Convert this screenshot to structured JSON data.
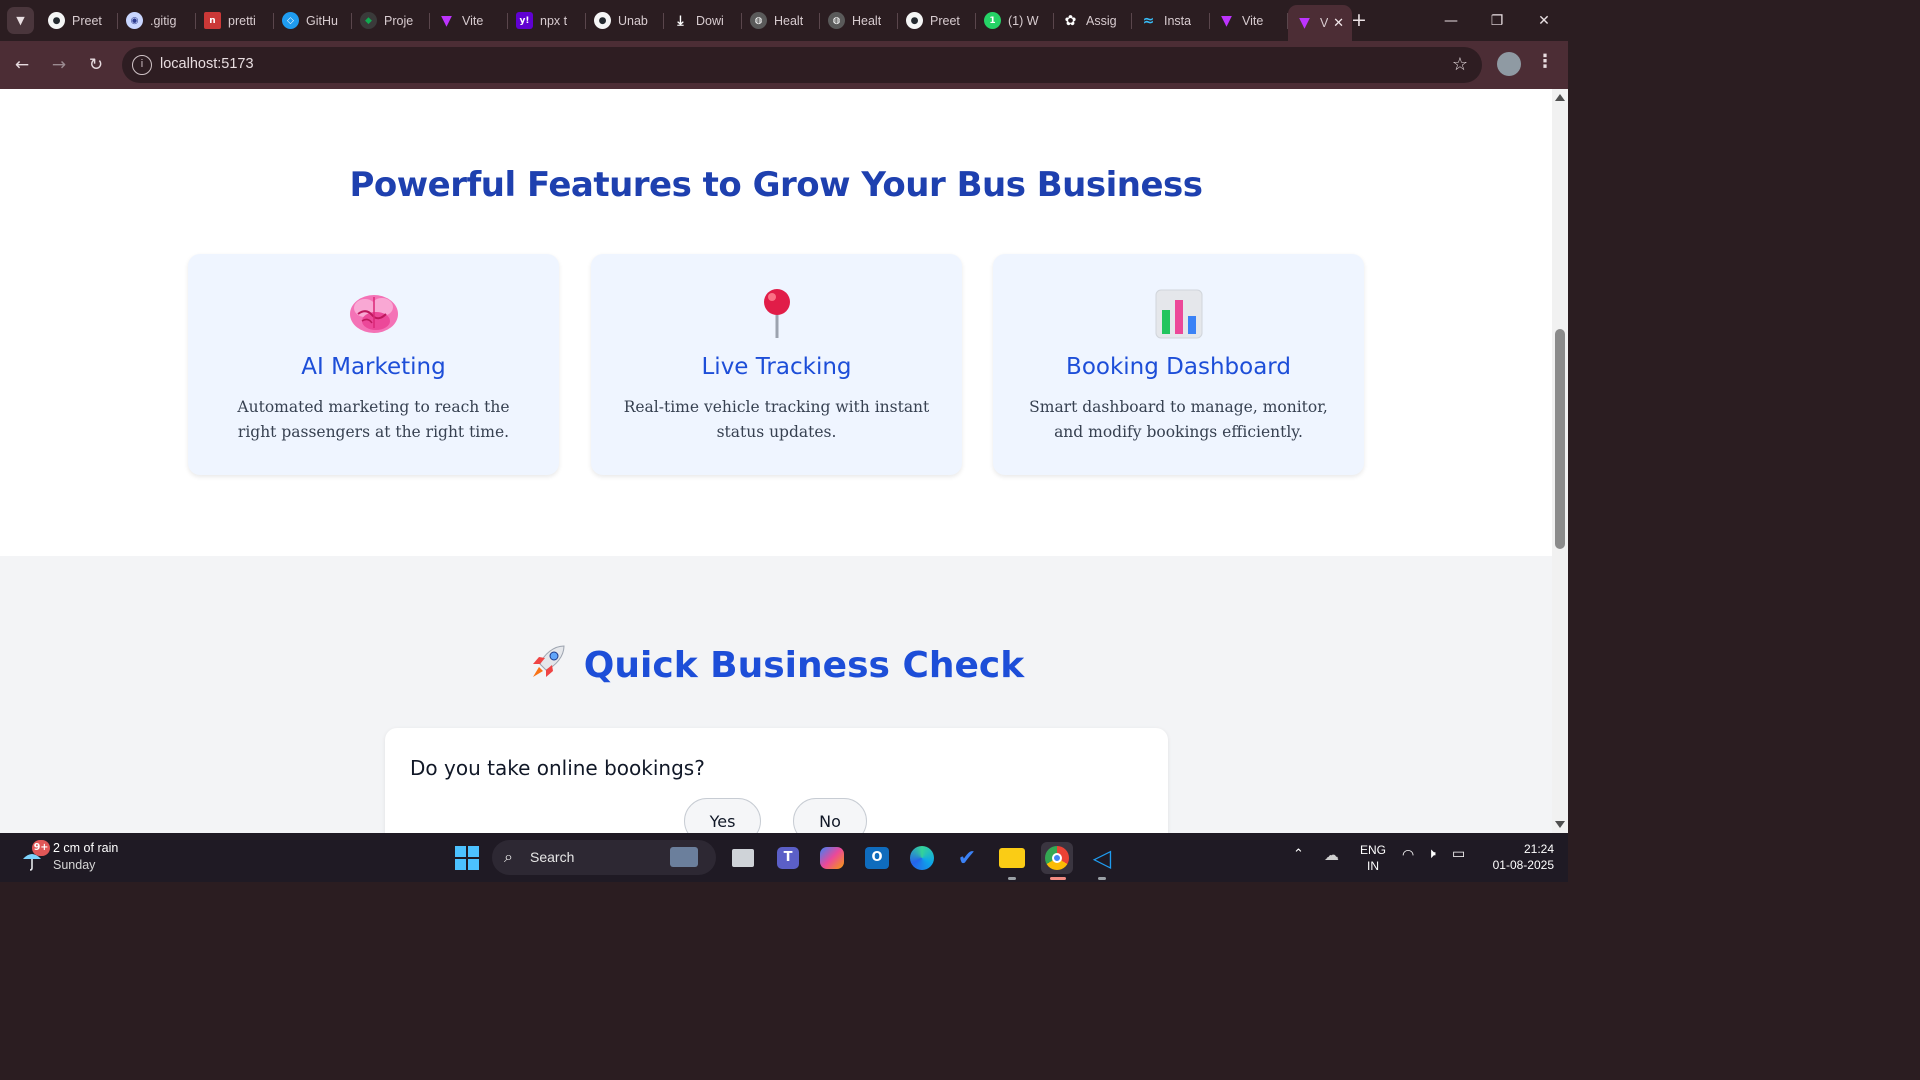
{
  "browser": {
    "tabs": [
      {
        "title": "Preet",
        "icon": "github-icon",
        "color": "#ffffff"
      },
      {
        "title": ".gitig",
        "icon": "avatar-icon",
        "color": "#c9d6ff"
      },
      {
        "title": "pretti",
        "icon": "npm-icon",
        "color": "#cb3837"
      },
      {
        "title": "GitHu",
        "icon": "vscode-icon",
        "color": "#1f9cf0"
      },
      {
        "title": "Proje",
        "icon": "mongodb-icon",
        "color": "#10aa50"
      },
      {
        "title": "Vite",
        "icon": "vite-icon",
        "color": "#a259ff"
      },
      {
        "title": "npx t",
        "icon": "yahoo-icon",
        "color": "#6001d2"
      },
      {
        "title": "Unab",
        "icon": "github-icon",
        "color": "#ffffff"
      },
      {
        "title": "Dowi",
        "icon": "download-icon",
        "color": "#ffffff"
      },
      {
        "title": "Healt",
        "icon": "globe-icon",
        "color": "#ffffff"
      },
      {
        "title": "Healt",
        "icon": "globe-icon",
        "color": "#ffffff"
      },
      {
        "title": "Preet",
        "icon": "github-icon",
        "color": "#ffffff"
      },
      {
        "title": "(1) W",
        "icon": "whatsapp-icon",
        "color": "#25d366"
      },
      {
        "title": "Assig",
        "icon": "openai-icon",
        "color": "#ffffff"
      },
      {
        "title": "Insta",
        "icon": "tailwind-icon",
        "color": "#38bdf8"
      },
      {
        "title": "Vite",
        "icon": "vite-icon",
        "color": "#a259ff"
      }
    ],
    "active_tab": {
      "title": "V",
      "icon": "vite-icon"
    },
    "url": "localhost:5173"
  },
  "features": {
    "heading": "Powerful Features to Grow Your Bus Business",
    "cards": [
      {
        "icon": "brain-icon",
        "title": "AI Marketing",
        "desc": "Automated marketing to reach the right passengers at the right time."
      },
      {
        "icon": "pushpin-icon",
        "title": "Live Tracking",
        "desc": "Real-time vehicle tracking with instant status updates."
      },
      {
        "icon": "bar-chart-icon",
        "title": "Booking Dashboard",
        "desc": "Smart dashboard to manage, monitor, and modify bookings efficiently."
      }
    ]
  },
  "quick_check": {
    "heading": "Quick Business Check",
    "icon": "rocket-icon",
    "question": "Do you take online bookings?",
    "yes": "Yes",
    "no": "No"
  },
  "taskbar": {
    "weather_title": "2 cm of rain",
    "weather_sub": "Sunday",
    "weather_badge": "9+",
    "search": "Search",
    "lang1": "ENG",
    "lang2": "IN",
    "time": "21:24",
    "date": "01-08-2025"
  },
  "colors": {
    "accent": "#1d4ed8",
    "heading": "#1e40af",
    "card_bg": "#eff5ff",
    "section_bg": "#f3f4f6"
  }
}
